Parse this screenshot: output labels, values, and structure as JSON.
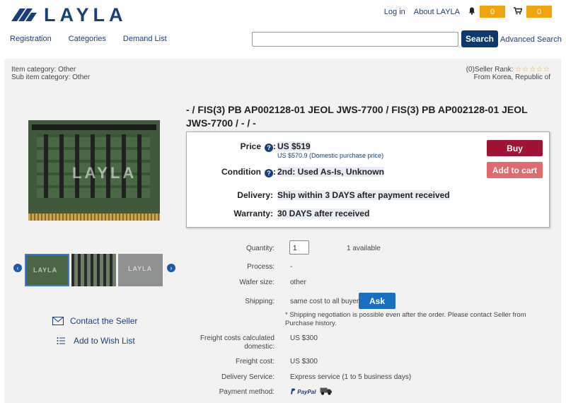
{
  "header": {
    "logo_text": "LAYLA",
    "login": "Log in",
    "about": "About LAYLA",
    "notify_count": "0",
    "cart_count": "0"
  },
  "nav": {
    "registration": "Registration",
    "categories": "Categories",
    "demand_list": "Demand List"
  },
  "search": {
    "placeholder": "",
    "button": "Search",
    "advanced": "Advanced Search"
  },
  "category": {
    "item_category": "Item category: Other",
    "sub_category": "Sub item category: Other"
  },
  "seller": {
    "rank_label": "(0)Seller Rank:",
    "stars": "☆☆☆☆☆",
    "origin": "From Korea, Republic of"
  },
  "product": {
    "title": "- / FIS(3) PB AP002128-01 JEOL JWS-7700 / FIS(3) PB AP002128-01 JEOL JWS-7700 / - / -",
    "image_watermark": "LAYLA"
  },
  "price_box": {
    "price_label": "Price",
    "price_value": "US $519",
    "domestic_price": "US $570.9 (Domestic purchase price)",
    "condition_label": "Condition",
    "condition_value": "2nd: Used As-Is, Unknown",
    "delivery_label": "Delivery:",
    "delivery_value": "Ship within 3 DAYS after payment received",
    "warranty_label": "Warranty:",
    "warranty_value": "30 DAYS after received",
    "buy": "Buy",
    "add_to_cart": "Add to cart"
  },
  "details": {
    "quantity_label": "Quantity:",
    "quantity_value": "1",
    "available": "1 available",
    "process_label": "Process:",
    "process_value": "-",
    "wafer_label": "Wafer size:",
    "wafer_value": "other",
    "shipping_label": "Shipping:",
    "shipping_value": "same cost to all buyers",
    "ask": "Ask",
    "shipping_note": "Shipping negotiation is possible even after the order. Please contact Seller from Purchase history.",
    "freight_domestic_label": "Freight costs calculated domestic:",
    "freight_domestic_value": "US $300",
    "freight_label": "Freight cost:",
    "freight_value": "US $300",
    "delivery_service_label": "Delivery Service:",
    "delivery_service_value": "Express service (1 to 5 business days)",
    "payment_label": "Payment method:",
    "paypal": "PayPal"
  },
  "actions": {
    "contact": "Contact the Seller",
    "wishlist": "Add to Wish List"
  },
  "thumbnails": {
    "t1": "LAYLA",
    "t2": "",
    "t3": "LAYLA"
  },
  "colors": {
    "brand": "#1a3e7a",
    "badge": "#f0a30a",
    "buy": "#9d1434",
    "cart": "#e06a70",
    "ask": "#1a6fc0"
  }
}
